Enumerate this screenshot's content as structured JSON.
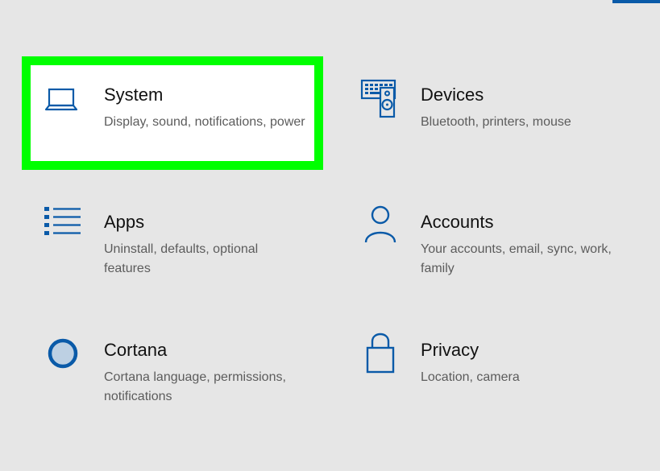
{
  "colors": {
    "accent": "#0a5aa8",
    "highlight": "#00ff00",
    "background": "#e6e6e6"
  },
  "settings": {
    "system": {
      "title": "System",
      "description": "Display, sound, notifications, power",
      "icon": "laptop-icon"
    },
    "devices": {
      "title": "Devices",
      "description": "Bluetooth, printers, mouse",
      "icon": "devices-icon"
    },
    "apps": {
      "title": "Apps",
      "description": "Uninstall, defaults, optional features",
      "icon": "apps-list-icon"
    },
    "accounts": {
      "title": "Accounts",
      "description": "Your accounts, email, sync, work, family",
      "icon": "person-icon"
    },
    "cortana": {
      "title": "Cortana",
      "description": "Cortana language, permissions, notifications",
      "icon": "cortana-circle-icon"
    },
    "privacy": {
      "title": "Privacy",
      "description": "Location, camera",
      "icon": "lock-icon"
    }
  }
}
